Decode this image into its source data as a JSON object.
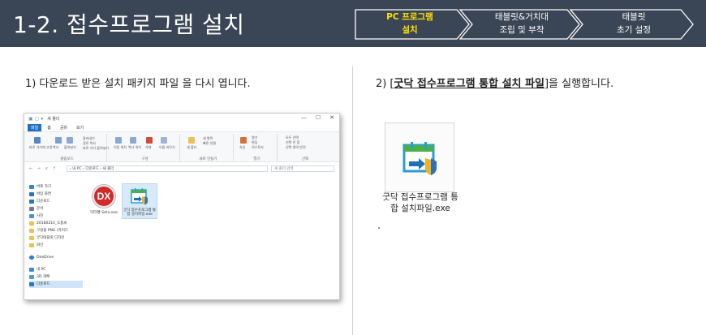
{
  "header": {
    "title": "1-2. 접수프로그램 설치",
    "steps": [
      {
        "line1": "PC 프로그램",
        "line2": "설치",
        "active": true
      },
      {
        "line1": "태블릿&거치대",
        "line2": "조립 및 부착",
        "active": false
      },
      {
        "line1": "태블릿",
        "line2": "초기 설정",
        "active": false
      }
    ],
    "colors": {
      "background": "#3a4656",
      "active_step": "#ffe100",
      "inactive_step": "#ffffff"
    }
  },
  "left": {
    "step_num": "1)",
    "instruction": "다운로드 받은 설치 패키지 파일 을 다시 엽니다."
  },
  "right": {
    "step_num": "2)",
    "bracket_open": "[",
    "highlight": "굿닥 접수프로그램 통합 설치 파일",
    "bracket_close": "]",
    "suffix": "을 실행합니다.",
    "file_label": "굿닥 접수프로그램 통합 설치파일.exe"
  },
  "explorer": {
    "window_title": "새 폴더",
    "window_buttons": [
      "—",
      "☐",
      "✕"
    ],
    "tabs": [
      "파일",
      "홈",
      "공유",
      "보기"
    ],
    "ribbon_groups": [
      {
        "name": "클립보드",
        "items": [
          "바로 가기에 고정",
          "복사",
          "붙여넣기",
          "잘라내기",
          "경로 복사",
          "바로 가기 붙여넣기"
        ]
      },
      {
        "name": "구성",
        "items": [
          "이동 위치",
          "복사 위치",
          "삭제",
          "이름 바꾸기"
        ]
      },
      {
        "name": "새로 만들기",
        "items": [
          "새 폴더",
          "새 항목",
          "빠른 연결"
        ]
      },
      {
        "name": "열기",
        "items": [
          "속성",
          "열기",
          "편집",
          "히스토리"
        ]
      },
      {
        "name": "선택",
        "items": [
          "모두 선택",
          "선택 안 함",
          "선택 영역 반전"
        ]
      }
    ],
    "nav_buttons": "← → ∨ ↑",
    "address_path": "› 내 PC › 다운로드 › 새 폴더",
    "search_placeholder": "새 폴더 검색",
    "nav_pane": [
      {
        "label": "바로 가기",
        "color": "#3b7fd0"
      },
      {
        "label": "바탕 화면",
        "color": "#2a72c8"
      },
      {
        "label": "다운로드",
        "color": "#2a72c8"
      },
      {
        "label": "문서",
        "color": "#6b7a8c"
      },
      {
        "label": "사진",
        "color": "#4a8fd8"
      },
      {
        "label": "20180214_도톰씨",
        "color": "#e8c15a"
      },
      {
        "label": "구성물 PNG (카이드",
        "color": "#e8c15a"
      },
      {
        "label": "굿닥태블릿 디자인",
        "color": "#e8c15a"
      },
      {
        "label": "화신",
        "color": "#e8c15a"
      },
      {
        "label": "OneDrive",
        "color": "#2b7be0"
      },
      {
        "label": "내 PC",
        "color": "#3a8ad8"
      },
      {
        "label": "3D 개체",
        "color": "#4a9ae0"
      },
      {
        "label": "다운로드",
        "color": "#2a72c8"
      }
    ],
    "files": [
      {
        "icon_text": "DX",
        "label": "닥터헬-Setu.exe"
      },
      {
        "label": "굿닥 접수프로그램 통합 설치파일.exe"
      }
    ]
  }
}
